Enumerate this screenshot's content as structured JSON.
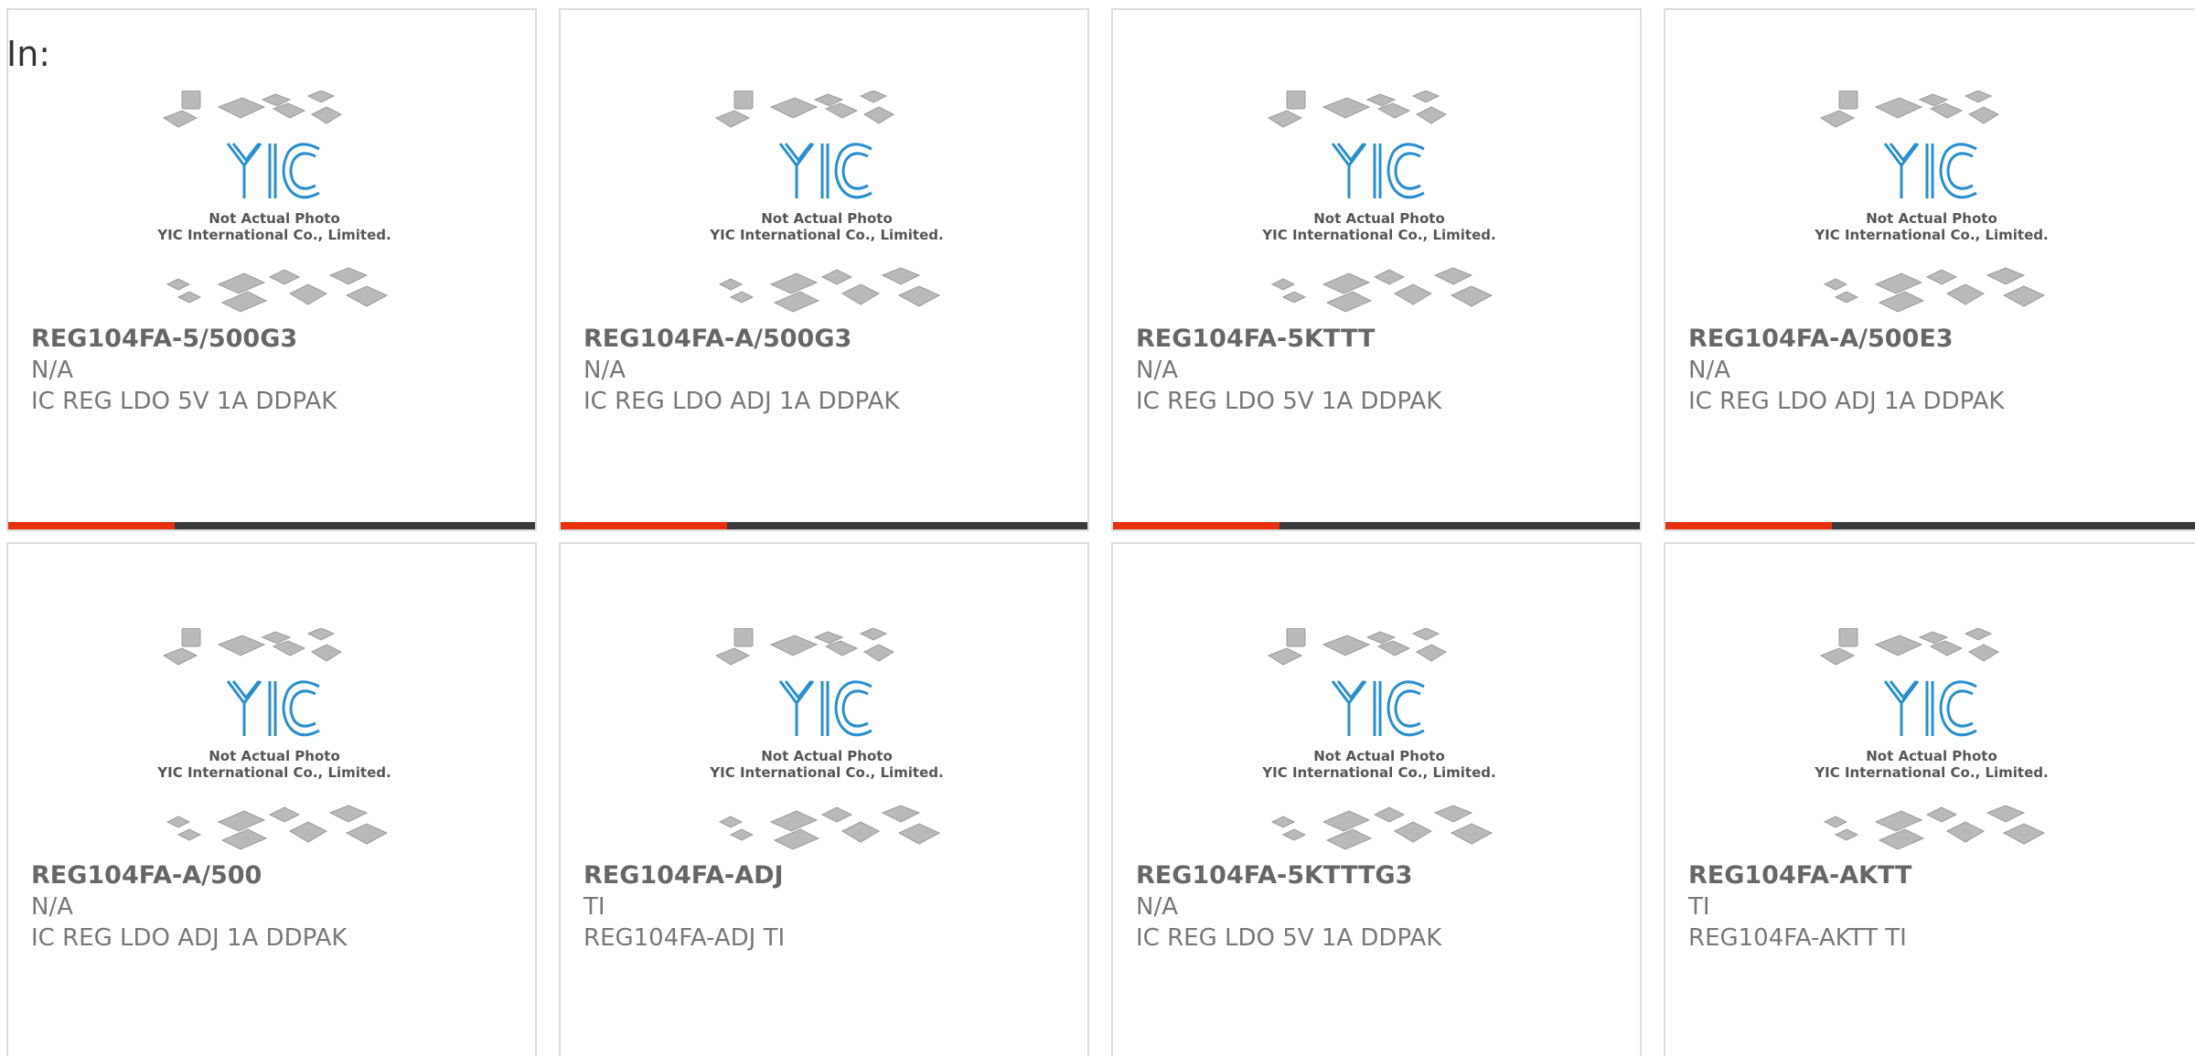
{
  "header": {
    "label": "In:"
  },
  "colors": {
    "accent": "#e8310e",
    "bar": "#3a3a3a",
    "logo_blue": "#2a8fcf",
    "text_gray": "#777777"
  },
  "placeholder": {
    "line1": "Not Actual Photo",
    "line2": "YIC International Co., Limited.",
    "logo_text": "YIC"
  },
  "products": [
    {
      "part_number": "REG104FA-5/500G3",
      "manufacturer": "N/A",
      "description": "IC REG LDO 5V 1A DDPAK"
    },
    {
      "part_number": "REG104FA-A/500G3",
      "manufacturer": "N/A",
      "description": "IC REG LDO ADJ 1A DDPAK"
    },
    {
      "part_number": "REG104FA-5KTTT",
      "manufacturer": "N/A",
      "description": "IC REG LDO 5V 1A DDPAK"
    },
    {
      "part_number": "REG104FA-A/500E3",
      "manufacturer": "N/A",
      "description": "IC REG LDO ADJ 1A DDPAK"
    },
    {
      "part_number": "REG104FA-A/500",
      "manufacturer": "N/A",
      "description": "IC REG LDO ADJ 1A DDPAK"
    },
    {
      "part_number": "REG104FA-ADJ",
      "manufacturer": "TI",
      "description": "REG104FA-ADJ TI"
    },
    {
      "part_number": "REG104FA-5KTTTG3",
      "manufacturer": "N/A",
      "description": "IC REG LDO 5V 1A DDPAK"
    },
    {
      "part_number": "REG104FA-AKTT",
      "manufacturer": "TI",
      "description": "REG104FA-AKTT TI"
    }
  ]
}
